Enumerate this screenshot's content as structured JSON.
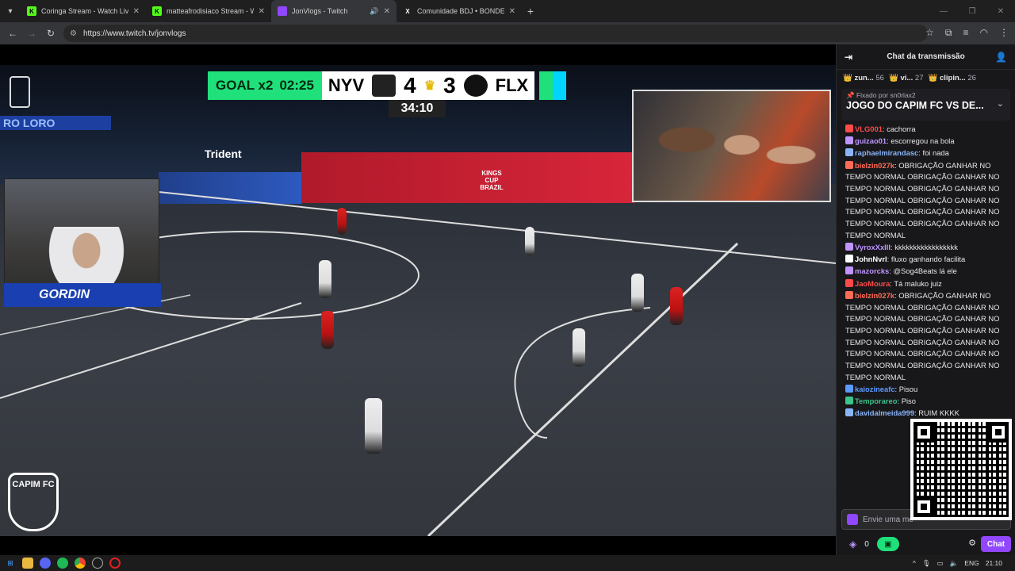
{
  "browser": {
    "tabs": [
      {
        "title": "Coringa Stream - Watch Live on",
        "fav": "K",
        "fav_color": "#53fc18",
        "active": false
      },
      {
        "title": "matteafrodisiaco Stream - Watc",
        "fav": "K",
        "fav_color": "#53fc18",
        "active": false
      },
      {
        "title": "JonVlogs - Twitch",
        "fav": "",
        "fav_color": "#9147ff",
        "active": true
      },
      {
        "title": "Comunidade BDJ • BONDE DO",
        "fav": "X",
        "fav_color": "#000000",
        "active": false
      }
    ],
    "url": "https://www.twitch.tv/jonvlogs"
  },
  "video": {
    "goal_label": "GOAL x2",
    "goal_time": "02:25",
    "team_home": "NYV",
    "score_home": "4",
    "score_away": "3",
    "team_away": "FLX",
    "match_clock": "34:10",
    "cam_name": "GORDIN",
    "logo_text": "CAPIM FC",
    "sponsor": "Trident",
    "board_text": "KINGS CUP BRAZIL",
    "stand_text": "RO LORO"
  },
  "chat": {
    "title": "Chat da transmissão",
    "viewers": [
      {
        "name": "zun...",
        "count": "56"
      },
      {
        "name": "vi...",
        "count": "27"
      },
      {
        "name": "clipin...",
        "count": "26"
      }
    ],
    "pinned_by_label": "Fixado por",
    "pinned_by": "sn0rlax2",
    "pinned_msg": "JOGO DO CAPIM FC VS DE...",
    "messages": [
      {
        "user": "VLG001",
        "color": "#ff4a4a",
        "text": "cachorra"
      },
      {
        "user": "guizao01",
        "color": "#bf94ff",
        "text": "escorregou na bola"
      },
      {
        "user": "raphaelmirandasc",
        "color": "#8ab4f8",
        "text": "foi nada"
      },
      {
        "user": "bielzin027k",
        "color": "#ff6b57",
        "text": "OBRIGAÇÃO GANHAR NO TEMPO NORMAL OBRIGAÇÃO GANHAR NO TEMPO NORMAL OBRIGAÇÃO GANHAR NO TEMPO NORMAL OBRIGAÇÃO GANHAR NO TEMPO NORMAL OBRIGAÇÃO GANHAR NO TEMPO NORMAL OBRIGAÇÃO GANHAR NO TEMPO NORMAL"
      },
      {
        "user": "VyroxXxIII",
        "color": "#bf94ff",
        "text": "kkkkkkkkkkkkkkkkk"
      },
      {
        "user": "JohnNvrl",
        "color": "#ffffff",
        "text": "fluxo ganhando facilita"
      },
      {
        "user": "mazorcks",
        "color": "#bf94ff",
        "text": "@Sog4Beats lá ele"
      },
      {
        "user": "JaoMoura",
        "color": "#ff4a4a",
        "text": "Tá maluko juiz"
      },
      {
        "user": "bielzin027k",
        "color": "#ff6b57",
        "text": "OBRIGAÇÃO GANHAR NO TEMPO NORMAL OBRIGAÇÃO GANHAR NO TEMPO NORMAL OBRIGAÇÃO GANHAR NO TEMPO NORMAL OBRIGAÇÃO GANHAR NO TEMPO NORMAL OBRIGAÇÃO GANHAR NO TEMPO NORMAL OBRIGAÇÃO GANHAR NO TEMPO NORMAL OBRIGAÇÃO GANHAR NO TEMPO NORMAL"
      },
      {
        "user": "kaiozineafc",
        "color": "#5b9bff",
        "text": "Pisou"
      },
      {
        "user": "Temporareo",
        "color": "#3cc48a",
        "text": "Piso"
      },
      {
        "user": "davidalmeida999",
        "color": "#8ab4f8",
        "text": "RUIM KKKK"
      }
    ],
    "input_placeholder": "Envie uma me",
    "points": "0",
    "send_label": "Chat"
  },
  "taskbar": {
    "lang": "ENG",
    "time": "21:10"
  }
}
